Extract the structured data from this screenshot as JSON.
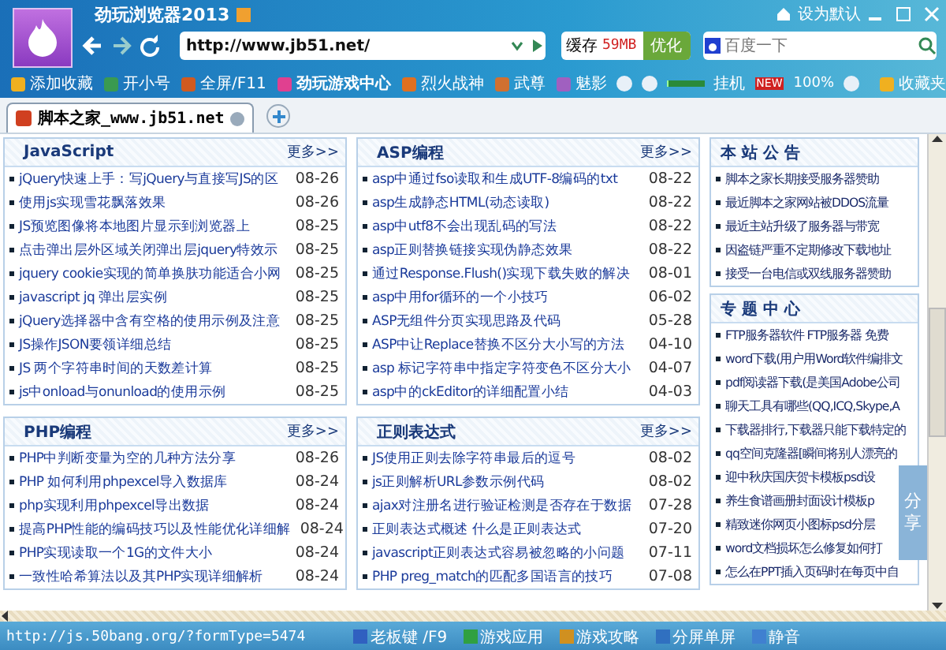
{
  "window": {
    "title": "劲玩浏览器2013",
    "set_default": "设为默认"
  },
  "toolbar": {
    "url": "http://www.jb51.net/",
    "cache_label": "缓存",
    "cache_value": "59MB",
    "optimize": "优化",
    "search_placeholder": "百度一下"
  },
  "bookmarks": [
    {
      "label": "添加收藏"
    },
    {
      "label": "开小号"
    },
    {
      "label": "全屏/F11"
    },
    {
      "label": "劲玩游戏中心",
      "bold": true
    },
    {
      "label": "烈火战神"
    },
    {
      "label": "武尊"
    },
    {
      "label": "魅影"
    }
  ],
  "player": {
    "level": 0.05,
    "game": "挂机",
    "badge": "NEW",
    "zoom": "100%",
    "favorites": "收藏夹"
  },
  "tabs": [
    {
      "label": "脚本之家_www.jb51.net",
      "selected": true
    }
  ],
  "columns": [
    [
      {
        "title": "JavaScript",
        "more": "更多>>",
        "rows": [
          {
            "text": "jQuery快速上手：写jQuery与直接写JS的区",
            "date": "08-26"
          },
          {
            "text": "使用js实现雪花飘落效果",
            "date": "08-26"
          },
          {
            "text": "JS预览图像将本地图片显示到浏览器上",
            "date": "08-25"
          },
          {
            "text": "点击弹出层外区域关闭弹出层jquery特效示",
            "date": "08-25"
          },
          {
            "text": "jquery cookie实现的简单换肤功能适合小网",
            "date": "08-25"
          },
          {
            "text": "javascript jq 弹出层实例",
            "date": "08-25"
          },
          {
            "text": "jQuery选择器中含有空格的使用示例及注意",
            "date": "08-25"
          },
          {
            "text": "JS操作JSON要领详细总结",
            "date": "08-25"
          },
          {
            "text": "JS 两个字符串时间的天数差计算",
            "date": "08-25"
          },
          {
            "text": "js中onload与onunload的使用示例",
            "date": "08-25"
          }
        ]
      },
      {
        "title": "PHP编程",
        "more": "更多>>",
        "rows": [
          {
            "text": "PHP中判断变量为空的几种方法分享",
            "date": "08-26"
          },
          {
            "text": "PHP 如何利用phpexcel导入数据库",
            "date": "08-24"
          },
          {
            "text": "php实现利用phpexcel导出数据",
            "date": "08-24"
          },
          {
            "text": "提高PHP性能的编码技巧以及性能优化详细解",
            "date": "08-24"
          },
          {
            "text": "PHP实现读取一个1G的文件大小",
            "date": "08-24"
          },
          {
            "text": "一致性哈希算法以及其PHP实现详细解析",
            "date": "08-24"
          }
        ]
      }
    ],
    [
      {
        "title": "ASP编程",
        "more": "更多>>",
        "rows": [
          {
            "text": "asp中通过fso读取和生成UTF-8编码的txt",
            "date": "08-22"
          },
          {
            "text": "asp生成静态HTML(动态读取)",
            "date": "08-22"
          },
          {
            "text": "asp中utf8不会出现乱码的写法",
            "date": "08-22"
          },
          {
            "text": "asp正则替换链接实现伪静态效果",
            "date": "08-22"
          },
          {
            "text": "通过Response.Flush()实现下载失败的解决",
            "date": "08-01"
          },
          {
            "text": "asp中用for循环的一个小技巧",
            "date": "06-02"
          },
          {
            "text": "ASP无组件分页实现思路及代码",
            "date": "05-28"
          },
          {
            "text": "ASP中让Replace替换不区分大小写的方法",
            "date": "04-10"
          },
          {
            "text": "asp 标记字符串中指定字符变色不区分大小",
            "date": "04-07"
          },
          {
            "text": "asp中的ckEditor的详细配置小结",
            "date": "04-03"
          }
        ]
      },
      {
        "title": "正则表达式",
        "more": "更多>>",
        "rows": [
          {
            "text": "JS使用正则去除字符串最后的逗号",
            "date": "08-02"
          },
          {
            "text": "js正则解析URL参数示例代码",
            "date": "08-02"
          },
          {
            "text": "ajax对注册名进行验证检测是否存在于数据",
            "date": "07-28"
          },
          {
            "text": "正则表达式概述 什么是正则表达式",
            "date": "07-20"
          },
          {
            "text": "javascript正则表达式容易被忽略的小问题",
            "date": "07-11"
          },
          {
            "text": "PHP preg_match的匹配多国语言的技巧",
            "date": "07-08"
          }
        ]
      }
    ]
  ],
  "sidebar": [
    {
      "title": "本 站 公 告",
      "rows": [
        "脚本之家长期接受服务器赞助",
        "最近脚本之家网站被DDOS流量",
        "最近主站升级了服务器与带宽",
        "因盗链严重不定期修改下载地址",
        "接受一台电信或双线服务器赞助"
      ]
    },
    {
      "title": "专 题 中 心",
      "rows": [
        "FTP服务器软件  FTP服务器 免费",
        "word下载(用户用Word软件编排文",
        "pdf阅读器下载(是美国Adobe公司",
        "聊天工具有哪些(QQ,ICQ,Skype,A",
        "下载器排行,下载器只能下载特定的",
        "qq空间克隆器[瞬间将别人漂亮的",
        "迎中秋庆国庆贺卡模板psd设",
        "养生食谱画册封面设计模板p",
        "精致迷你网页小图标psd分层",
        "word文档损坏怎么修复如何打",
        "怎么在PPT插入页码时在每页中自"
      ]
    }
  ],
  "share": "分享",
  "status": {
    "url": "http://js.50bang.org/?formType=5474",
    "items": [
      {
        "label": "老板键 /F9"
      },
      {
        "label": "游戏应用"
      },
      {
        "label": "游戏攻略"
      },
      {
        "label": "分屏单屏"
      },
      {
        "label": "静音"
      }
    ]
  }
}
